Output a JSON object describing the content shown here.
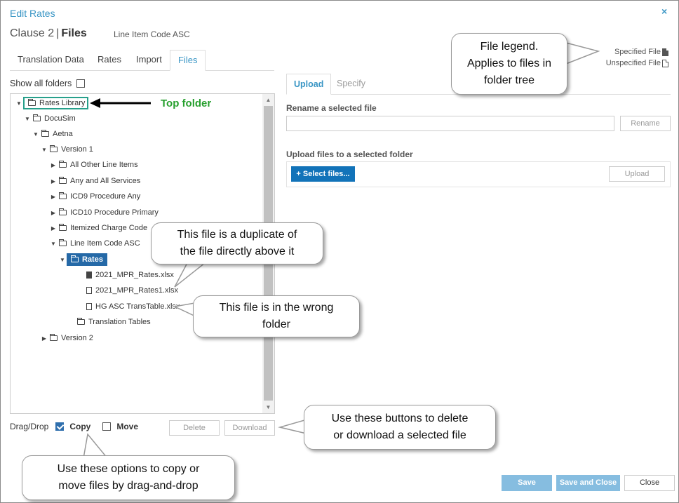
{
  "dialog": {
    "title": "Edit Rates",
    "close_glyph": "×",
    "clause_prefix": "Clause 2",
    "clause_sep": "|",
    "clause_section": "Files",
    "clause_sub": "Line Item Code ASC"
  },
  "legend": {
    "specified": "Specified File",
    "unspecified": "Unspecified File"
  },
  "tabs": [
    "Translation Data",
    "Rates",
    "Import",
    "Files"
  ],
  "active_tab": "Files",
  "show_all_folders": {
    "label": "Show all folders",
    "checked": false
  },
  "tree": [
    {
      "label": "Rates Library",
      "toggle": "▼",
      "icon": "folder",
      "state": "highlighted"
    },
    {
      "label": "DocuSim",
      "toggle": "▼",
      "icon": "folder"
    },
    {
      "label": "Aetna",
      "toggle": "▼",
      "icon": "folder"
    },
    {
      "label": "Version 1",
      "toggle": "▼",
      "icon": "folder"
    },
    {
      "label": "All Other Line Items",
      "toggle": "▶",
      "icon": "folder"
    },
    {
      "label": "Any and All Services",
      "toggle": "▶",
      "icon": "folder"
    },
    {
      "label": "ICD9 Procedure Any",
      "toggle": "▶",
      "icon": "folder"
    },
    {
      "label": "ICD10 Procedure Primary",
      "toggle": "▶",
      "icon": "folder"
    },
    {
      "label": "Itemized Charge Code",
      "toggle": "▶",
      "icon": "folder"
    },
    {
      "label": "Line Item Code ASC",
      "toggle": "▼",
      "icon": "folder"
    },
    {
      "label": "Rates",
      "toggle": "▼",
      "icon": "folder",
      "state": "selected"
    },
    {
      "label": "2021_MPR_Rates.xlsx",
      "toggle": "",
      "icon": "file-specified"
    },
    {
      "label": "2021_MPR_Rates1.xlsx",
      "toggle": "",
      "icon": "file-unspecified"
    },
    {
      "label": "HG ASC TransTable.xlsx",
      "toggle": "",
      "icon": "file-unspecified"
    },
    {
      "label": "Translation Tables",
      "toggle": "",
      "icon": "folder"
    },
    {
      "label": "Version 2",
      "toggle": "▶",
      "icon": "folder"
    }
  ],
  "dragdrop": {
    "label": "Drag/Drop",
    "copy": "Copy",
    "copy_checked": true,
    "move": "Move",
    "move_checked": false
  },
  "file_buttons": {
    "delete": "Delete",
    "download": "Download"
  },
  "right_tabs": [
    "Upload",
    "Specify"
  ],
  "active_right_tab": "Upload",
  "rename": {
    "label": "Rename a selected file",
    "value": "",
    "button": "Rename"
  },
  "upload": {
    "label": "Upload files to a selected folder",
    "select_button": "Select files...",
    "upload_button": "Upload"
  },
  "footer": {
    "save": "Save",
    "save_close": "Save and Close",
    "close": "Close"
  },
  "annotations": {
    "top_folder": "Top folder",
    "legend_note": "File legend.\nApplies to files in\nfolder tree",
    "duplicate_note": "This file is a duplicate of\nthe file directly above it",
    "wrong_folder_note": "This file is in the wrong\nfolder",
    "buttons_note": "Use these buttons to delete\nor download a selected file",
    "dragdrop_note": "Use these options to copy or\nmove files by drag-and-drop"
  },
  "colors": {
    "accent": "#3a96c5",
    "selected": "#2569a7",
    "highlight_box": "#27a08b",
    "annotation_green": "#27a02e"
  }
}
